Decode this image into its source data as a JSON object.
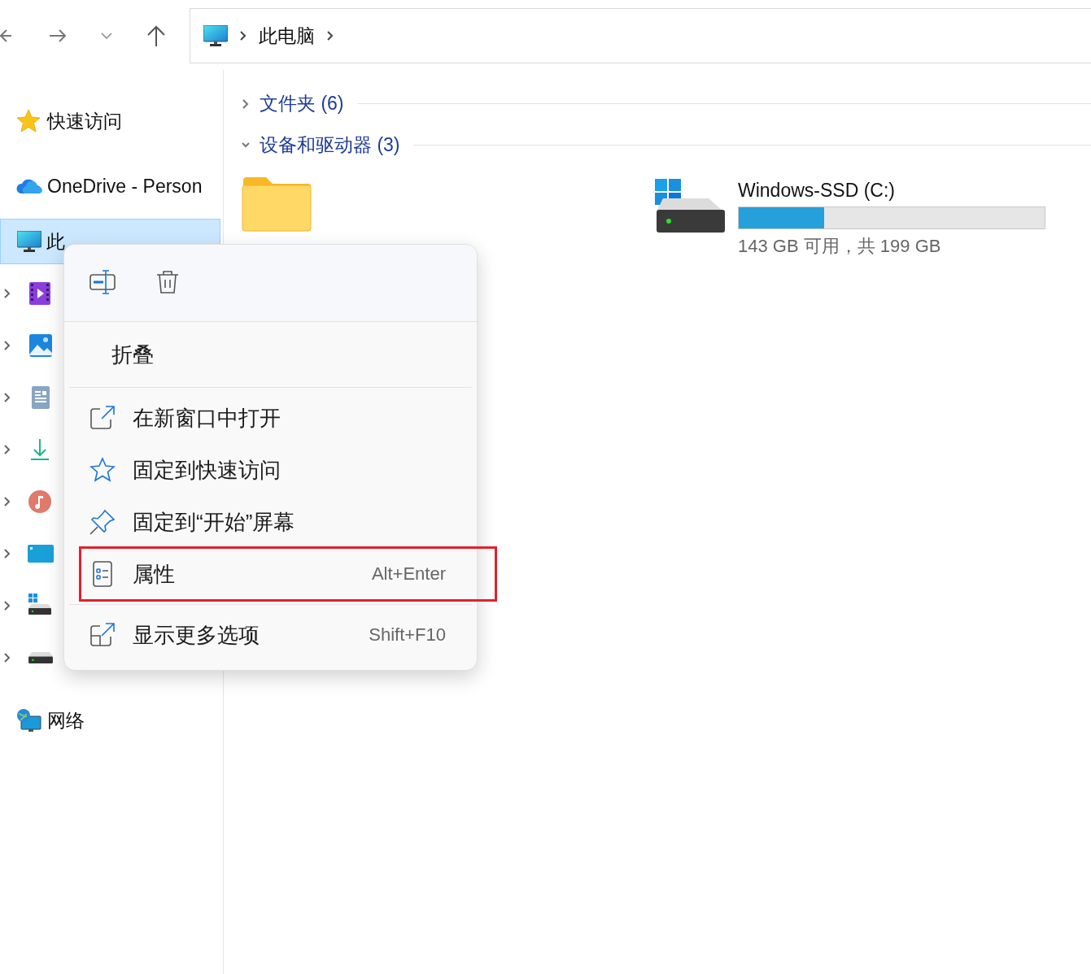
{
  "nav": {
    "breadcrumb": [
      "此电脑"
    ]
  },
  "sidebar": {
    "items": [
      {
        "kind": "star",
        "label": "快速访问",
        "selected": false
      },
      {
        "kind": "cloud",
        "label": "OneDrive - Person",
        "selected": false
      },
      {
        "kind": "pc",
        "label": "此",
        "selected": true
      },
      {
        "kind": "video",
        "selected": false
      },
      {
        "kind": "pictures",
        "selected": false
      },
      {
        "kind": "documents",
        "selected": false
      },
      {
        "kind": "downloads",
        "selected": false
      },
      {
        "kind": "music",
        "selected": false
      },
      {
        "kind": "desktop",
        "selected": false
      },
      {
        "kind": "windows-drive",
        "selected": false
      },
      {
        "kind": "drive",
        "selected": false
      },
      {
        "kind": "network",
        "label": "网络",
        "selected": false
      }
    ]
  },
  "content": {
    "sections": [
      {
        "label": "文件夹 (6)",
        "expanded": false
      },
      {
        "label": "设备和驱动器 (3)",
        "expanded": true
      }
    ],
    "items": [
      {
        "kind": "folder"
      },
      {
        "kind": "windows-drive",
        "name": "Windows-SSD (C:)",
        "level": 0.28,
        "space": "143 GB 可用，共 199 GB"
      }
    ]
  },
  "context_menu": {
    "quick_actions": [
      {
        "kind": "rename"
      },
      {
        "kind": "delete"
      }
    ],
    "groups": [
      [
        {
          "kind": "none",
          "label": "折叠",
          "highlighted": false
        }
      ],
      [
        {
          "kind": "open-window",
          "label": "在新窗口中打开",
          "highlighted": false
        },
        {
          "kind": "star",
          "label": "固定到快速访问",
          "highlighted": false
        },
        {
          "kind": "pin",
          "label": "固定到“开始”屏幕",
          "highlighted": false
        },
        {
          "kind": "properties",
          "label": "属性",
          "shortcut": "Alt+Enter",
          "highlighted": true
        }
      ],
      [
        {
          "kind": "more",
          "label": "显示更多选项",
          "shortcut": "Shift+F10",
          "highlighted": false
        }
      ]
    ]
  }
}
